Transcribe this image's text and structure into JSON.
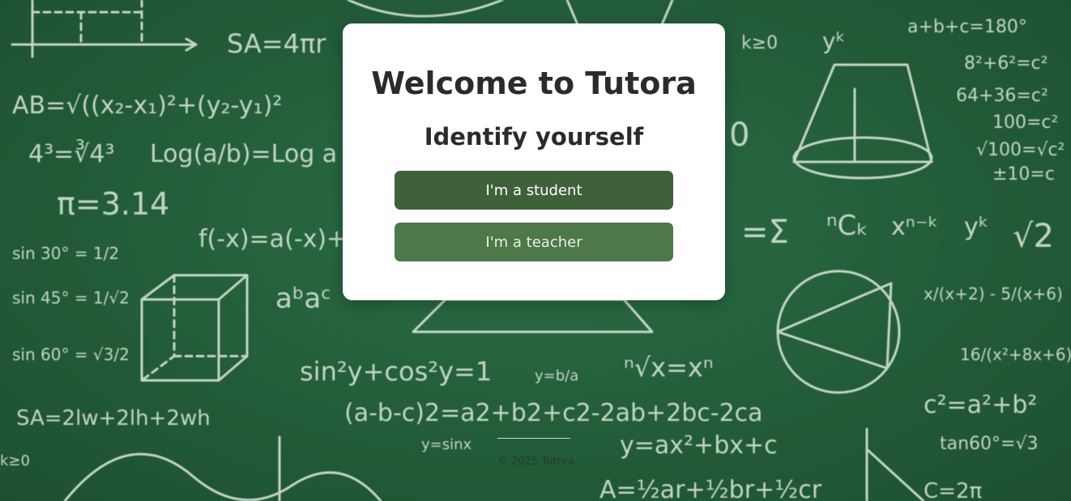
{
  "card": {
    "title": "Welcome to Tutora",
    "subtitle": "Identify yourself",
    "student_button_label": "I'm a student",
    "teacher_button_label": "I'm a teacher"
  },
  "footer": {
    "copyright": "© 2025 Tutora"
  },
  "colors": {
    "student_button": "#3f613a",
    "teacher_button": "#4e774a",
    "card_background": "#ffffff",
    "chalkboard": "#245f3c"
  }
}
